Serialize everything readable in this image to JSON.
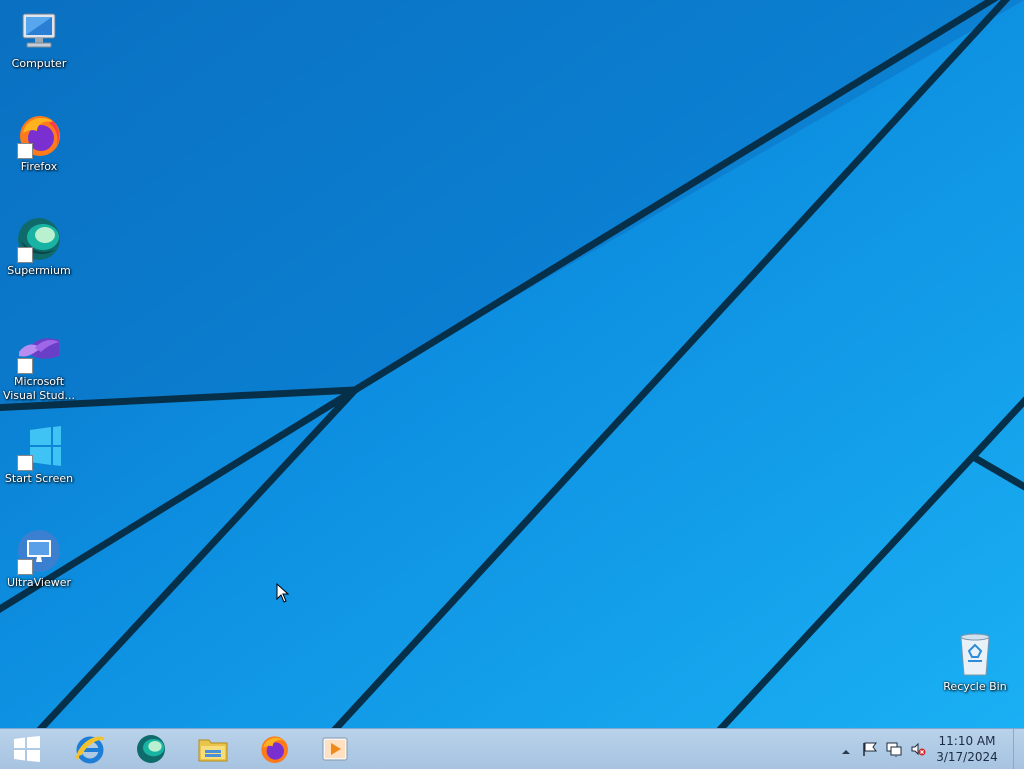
{
  "desktop": {
    "icons": [
      {
        "label": "Computer",
        "icon": "computer-icon"
      },
      {
        "label": "Firefox",
        "icon": "firefox-icon"
      },
      {
        "label": "Supermium",
        "icon": "supermium-icon"
      },
      {
        "label": "Microsoft Visual Stud...",
        "icon": "visual-studio-icon"
      },
      {
        "label": "Start Screen",
        "icon": "windows-icon"
      },
      {
        "label": "UltraViewer",
        "icon": "ultraviewer-icon"
      },
      {
        "label": "Recycle Bin",
        "icon": "recycle-bin-icon"
      }
    ]
  },
  "taskbar": {
    "pinned": [
      {
        "icon": "internet-explorer-icon"
      },
      {
        "icon": "supermium-icon"
      },
      {
        "icon": "file-explorer-icon"
      },
      {
        "icon": "firefox-icon"
      },
      {
        "icon": "media-player-icon"
      }
    ],
    "tray": {
      "time": "11:10 AM",
      "date": "3/17/2024",
      "icons": [
        "show-hidden-icons-icon",
        "action-center-flag-icon",
        "network-icon",
        "volume-muted-icon"
      ]
    }
  },
  "colors": {
    "wallpaper_light": "#1aa6ee",
    "wallpaper_dark": "#0a6fc0",
    "taskbar": "#b9d2ea"
  }
}
